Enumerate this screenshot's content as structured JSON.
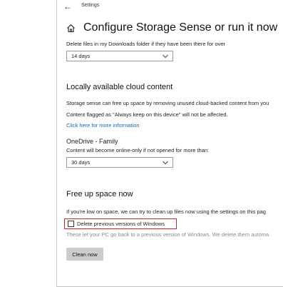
{
  "window": {
    "title": "Settings"
  },
  "page": {
    "title": "Configure Storage Sense or run it now"
  },
  "downloads": {
    "label": "Delete files in my Downloads folder if they have been there for over",
    "selected": "14 days"
  },
  "cloud": {
    "heading": "Locally available cloud content",
    "desc1": "Storage sense can free up space by removing unused cloud-backed content from you",
    "desc2": "Content flagged as \"Always keep on this device\" will not be affected.",
    "link": "Click here for more information",
    "account": "OneDrive - Family",
    "account_desc": "Content will become online-only if not opened for more than:",
    "selected": "30 days"
  },
  "free_up": {
    "heading": "Free up space now",
    "desc": "If you're low on space, we can try to clean up files now using the settings on this pag",
    "checkbox_label": "Delete previous versions of Windows",
    "checkbox_checked": false,
    "note": "These let your PC go back to a previous version of Windows. We delete them automa",
    "button": "Clean now"
  },
  "icons": {
    "back": "back-arrow-icon",
    "home": "home-icon",
    "chevron": "chevron-down-icon"
  },
  "colors": {
    "link": "#1a5fb4",
    "highlight": "#c0282d",
    "button_bg": "#cccccc"
  }
}
